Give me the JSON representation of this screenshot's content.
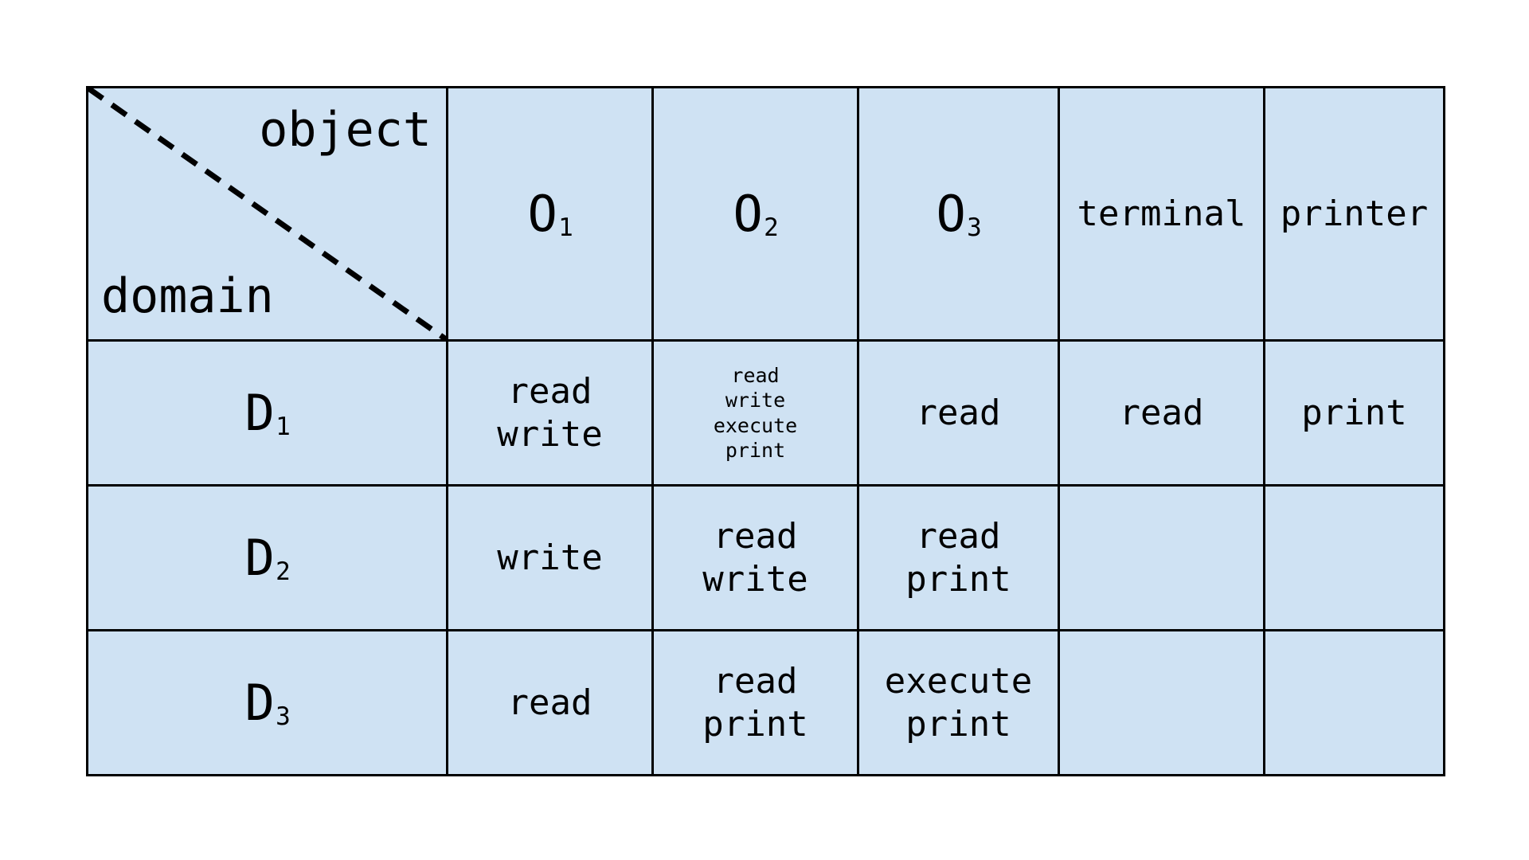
{
  "figure": {
    "kind": "access-control-matrix",
    "fill_color": "#cfe2f3",
    "border_color": "#000000",
    "background_color": "#ffffff",
    "corner": {
      "object_label": "object",
      "domain_label": "domain",
      "divider": "dashed-diagonal"
    }
  },
  "chart_data": {
    "type": "table",
    "title": "",
    "corner_labels": {
      "columns": "object",
      "rows": "domain"
    },
    "columns": [
      {
        "base": "O",
        "sub": "1",
        "display": "O₁"
      },
      {
        "base": "O",
        "sub": "2",
        "display": "O₂"
      },
      {
        "base": "O",
        "sub": "3",
        "display": "O₃"
      },
      {
        "base": "terminal",
        "sub": "",
        "display": "terminal"
      },
      {
        "base": "printer",
        "sub": "",
        "display": "printer"
      }
    ],
    "rows": [
      {
        "base": "D",
        "sub": "1",
        "display": "D₁"
      },
      {
        "base": "D",
        "sub": "2",
        "display": "D₂"
      },
      {
        "base": "D",
        "sub": "3",
        "display": "D₃"
      }
    ],
    "cells": [
      [
        {
          "text": "read\nwrite",
          "compact": false
        },
        {
          "text": "read\nwrite\nexecute\nprint",
          "compact": true
        },
        {
          "text": "read",
          "compact": false
        },
        {
          "text": "read",
          "compact": false
        },
        {
          "text": "print",
          "compact": false
        }
      ],
      [
        {
          "text": "write",
          "compact": false
        },
        {
          "text": "read\nwrite",
          "compact": false
        },
        {
          "text": "read\nprint",
          "compact": false
        },
        {
          "text": "",
          "compact": false
        },
        {
          "text": "",
          "compact": false
        }
      ],
      [
        {
          "text": "read",
          "compact": false
        },
        {
          "text": "read\nprint",
          "compact": false
        },
        {
          "text": "execute\nprint",
          "compact": false
        },
        {
          "text": "",
          "compact": false
        },
        {
          "text": "",
          "compact": false
        }
      ]
    ]
  }
}
